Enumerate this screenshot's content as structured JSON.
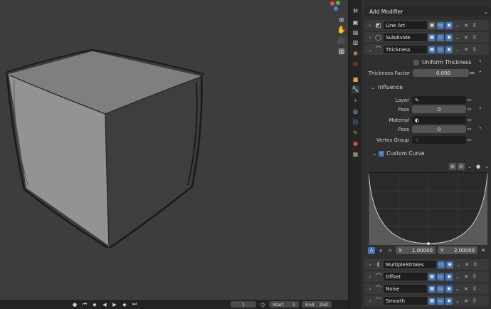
{
  "panel": {
    "add_modifier": "Add Modifier",
    "modifiers": [
      {
        "name": "Line Art",
        "icon": "line-art-icon",
        "expanded": false
      },
      {
        "name": "Subdivide",
        "icon": "subdivide-icon",
        "expanded": false
      },
      {
        "name": "Thickness",
        "icon": "thickness-icon",
        "expanded": true
      }
    ],
    "thickness": {
      "uniform_label": "Uniform Thickness",
      "uniform_checked": false,
      "factor_label": "Thickness Factor",
      "factor_value": "0.000",
      "influence_label": "Influence",
      "layer_label": "Layer",
      "layer_pass_label": "Pass",
      "layer_pass_value": "0",
      "material_label": "Material",
      "material_pass_label": "Pass",
      "material_pass_value": "0",
      "vertex_group_label": "Vertex Group",
      "custom_curve_label": "Custom Curve",
      "custom_curve_checked": true,
      "x_label": "X",
      "x_value": "1.00000",
      "y_label": "Y",
      "y_value": "2.00000"
    },
    "bottom_modifiers": [
      {
        "name": "MultipleStrokes",
        "icon": "multiple-strokes-icon"
      },
      {
        "name": "Offset",
        "icon": "offset-icon"
      },
      {
        "name": "Noise",
        "icon": "noise-icon"
      },
      {
        "name": "Smooth",
        "icon": "smooth-icon"
      }
    ]
  },
  "timeline": {
    "current_frame": "1",
    "start_label": "Start",
    "start_value": "1",
    "end_label": "End",
    "end_value": "250"
  },
  "colors": {
    "accent": "#4772b3",
    "panel_bg": "#2f2f2f",
    "viewport_bg": "#3d3d3d"
  }
}
